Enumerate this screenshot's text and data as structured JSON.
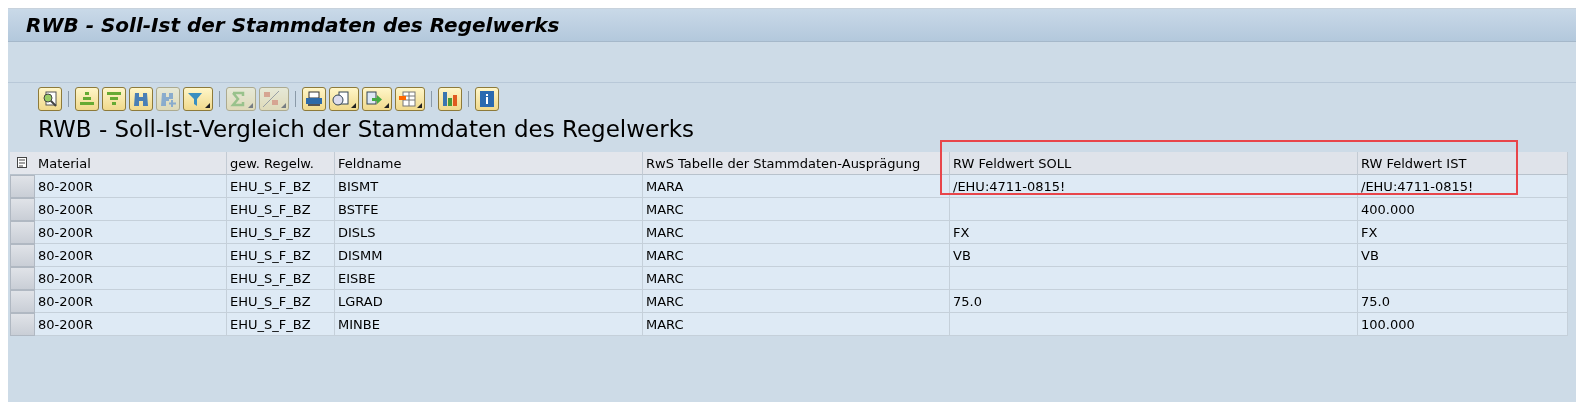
{
  "window": {
    "title": "RWB - Soll-Ist der Stammdaten des Regelwerks"
  },
  "toolbar": [
    [
      {
        "kind": "details",
        "disabled": false,
        "dropdown": false
      }
    ],
    [
      {
        "kind": "sort-up",
        "disabled": false,
        "dropdown": false
      },
      {
        "kind": "sort-down",
        "disabled": false,
        "dropdown": false
      },
      {
        "kind": "find",
        "disabled": false,
        "dropdown": false
      },
      {
        "kind": "find-next",
        "disabled": true,
        "dropdown": false
      },
      {
        "kind": "filter",
        "disabled": false,
        "dropdown": true
      }
    ],
    [
      {
        "kind": "sum",
        "disabled": true,
        "dropdown": true
      },
      {
        "kind": "subtotal",
        "disabled": true,
        "dropdown": true
      }
    ],
    [
      {
        "kind": "print",
        "disabled": false,
        "dropdown": false
      },
      {
        "kind": "views",
        "disabled": false,
        "dropdown": true
      },
      {
        "kind": "export",
        "disabled": false,
        "dropdown": true
      },
      {
        "kind": "layout",
        "disabled": false,
        "dropdown": true
      }
    ],
    [
      {
        "kind": "chart",
        "disabled": false,
        "dropdown": false
      }
    ],
    [
      {
        "kind": "info",
        "disabled": false,
        "dropdown": false
      }
    ]
  ],
  "heading": "RWB - Soll-Ist-Vergleich der Stammdaten des Regelwerks",
  "table": {
    "columns": [
      {
        "label": "Material",
        "highlighted": false
      },
      {
        "label": "gew. Regelw.",
        "highlighted": false
      },
      {
        "label": "Feldname",
        "highlighted": false
      },
      {
        "label": "RwS Tabelle der Stammdaten-Ausprägung",
        "highlighted": false
      },
      {
        "label": "RW Feldwert SOLL",
        "highlighted": true
      },
      {
        "label": "RW Feldwert IST",
        "highlighted": true
      }
    ],
    "rows": [
      {
        "cells": {
          "material": "80-200R",
          "rule": "EHU_S_F_BZ",
          "field": "BISMT",
          "table": "MARA",
          "soll": "/EHU:4711-0815!",
          "ist": "/EHU:4711-0815!"
        }
      },
      {
        "cells": {
          "material": "80-200R",
          "rule": "EHU_S_F_BZ",
          "field": "BSTFE",
          "table": "MARC",
          "ist": "400.000"
        }
      },
      {
        "cells": {
          "material": "80-200R",
          "rule": "EHU_S_F_BZ",
          "field": "DISLS",
          "table": "MARC",
          "soll": "FX",
          "ist": "FX"
        }
      },
      {
        "cells": {
          "material": "80-200R",
          "rule": "EHU_S_F_BZ",
          "field": "DISMM",
          "table": "MARC",
          "soll": "VB",
          "ist": "VB"
        }
      },
      {
        "cells": {
          "material": "80-200R",
          "rule": "EHU_S_F_BZ",
          "field": "EISBE",
          "table": "MARC"
        }
      },
      {
        "cells": {
          "material": "80-200R",
          "rule": "EHU_S_F_BZ",
          "field": "LGRAD",
          "table": "MARC",
          "soll": "75.0",
          "ist": "75.0"
        }
      },
      {
        "cells": {
          "material": "80-200R",
          "rule": "EHU_S_F_BZ",
          "field": "MINBE",
          "table": "MARC",
          "ist": "100.000"
        }
      }
    ]
  }
}
